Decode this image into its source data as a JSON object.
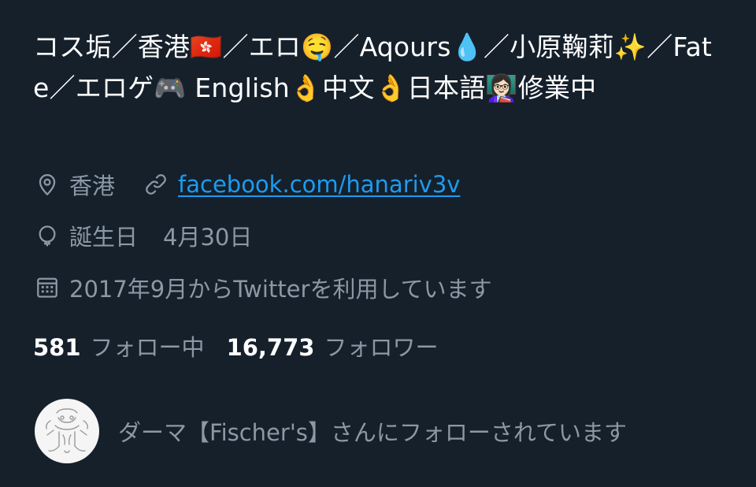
{
  "profile": {
    "bio": "コス垢／香港🇭🇰／エロ🤤／Aqours💧／小原鞠莉✨／Fate／エロゲ🎮 English👌中文👌日本語👩🏻‍🏫修業中",
    "location": "香港",
    "website": "facebook.com/hanariv3v",
    "birthday_label": "誕生日",
    "birthday_value": "4月30日",
    "joined": "2017年9月からTwitterを利用しています"
  },
  "stats": {
    "following_count": "581",
    "following_label": "フォロー中",
    "followers_count": "16,773",
    "followers_label": "フォロワー"
  },
  "followed_by": {
    "text": "ダーマ【Fischer's】さんにフォローされています"
  },
  "icons": {
    "location": "location-pin-icon",
    "link": "link-icon",
    "birthday": "balloon-icon",
    "joined": "calendar-icon"
  },
  "colors": {
    "background": "#15202b",
    "primary_text": "#ffffff",
    "secondary_text": "#8b98a5",
    "link": "#1d9bf0"
  }
}
